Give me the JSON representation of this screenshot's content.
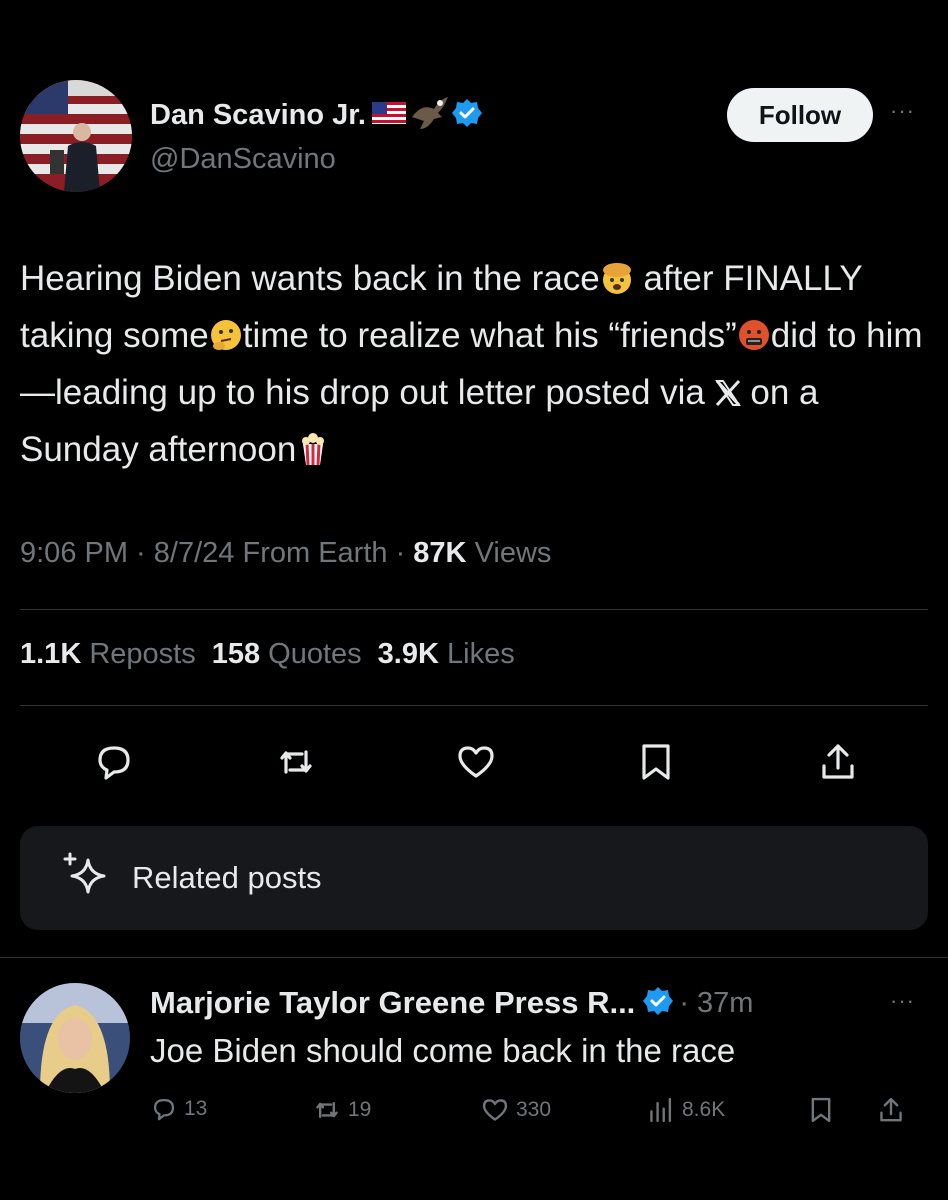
{
  "tweet": {
    "author_name": "Dan Scavino Jr.",
    "author_handle": "@DanScavino",
    "follow_label": "Follow",
    "more_label": "···",
    "text_segments": [
      "Hearing Biden wants back in the race",
      "after FINALLY taking some",
      "time to realize what his “friends”",
      "did to him—leading up to his drop out letter posted via",
      "on a Sunday afternoon"
    ],
    "emojis": [
      "exploding-head-emoji",
      "thinking-face-emoji",
      "face-with-symbols-emoji",
      "x-logo",
      "popcorn-emoji"
    ],
    "time": "9:06 PM",
    "date": "8/7/24",
    "source": "From Earth",
    "views_count": "87K",
    "views_label": "Views",
    "reposts_count": "1.1K",
    "reposts_label": "Reposts",
    "quotes_count": "158",
    "quotes_label": "Quotes",
    "likes_count": "3.9K",
    "likes_label": "Likes",
    "actions": [
      "reply-icon",
      "repost-icon",
      "like-icon",
      "bookmark-icon",
      "share-icon"
    ]
  },
  "related": {
    "label": "Related posts"
  },
  "reply": {
    "author_name": "Marjorie Taylor Greene Press R...",
    "time": "37m",
    "more_label": "···",
    "text": "Joe Biden should come back in the race",
    "reply_count": "13",
    "repost_count": "19",
    "like_count": "330",
    "views_count": "8.6K"
  },
  "colors": {
    "background": "#000000",
    "text": "#e7e9ea",
    "muted": "#71767b",
    "verified": "#1d9bf0",
    "card": "#16181c"
  }
}
